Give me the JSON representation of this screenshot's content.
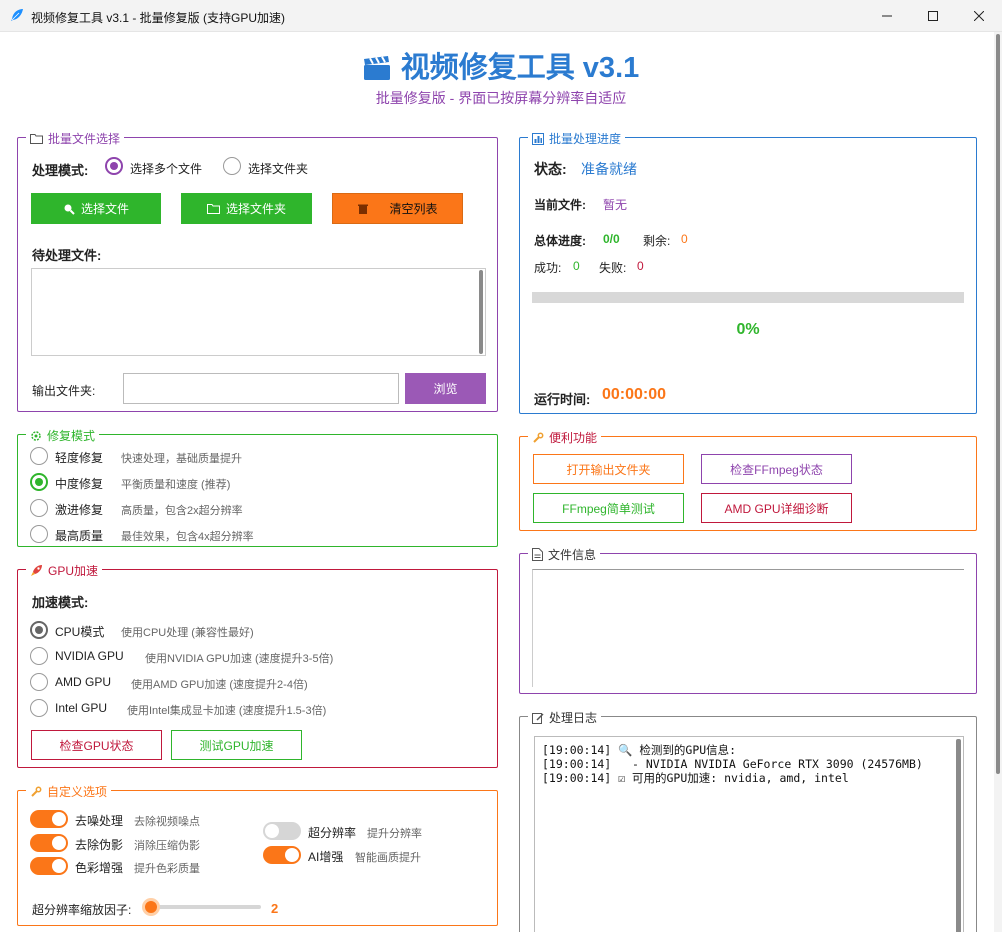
{
  "window": {
    "title": "视频修复工具 v3.1 - 批量修复版 (支持GPU加速)",
    "minimize": "—",
    "maximize": "☐",
    "close": "✕"
  },
  "header": {
    "title": "视频修复工具 v3.1",
    "subtitle": "批量修复版 - 界面已按屏幕分辨率自适应"
  },
  "batch": {
    "legend": "批量文件选择",
    "mode_label": "处理模式:",
    "mode_options": [
      "选择多个文件",
      "选择文件夹"
    ],
    "mode_selected": "选择多个文件",
    "select_files": "选择文件",
    "select_folder": "选择文件夹",
    "clear_list": "清空列表",
    "pending_label": "待处理文件:",
    "output_label": "输出文件夹:",
    "output_value": "",
    "browse": "浏览"
  },
  "repair": {
    "legend": "修复模式",
    "selected": "中度修复",
    "options": [
      {
        "label": "轻度修复",
        "hint": "快速处理，基础质量提升"
      },
      {
        "label": "中度修复",
        "hint": "平衡质量和速度 (推荐)"
      },
      {
        "label": "激进修复",
        "hint": "高质量，包含2x超分辨率"
      },
      {
        "label": "最高质量",
        "hint": "最佳效果，包含4x超分辨率"
      }
    ]
  },
  "gpu": {
    "legend": "GPU加速",
    "mode_label": "加速模式:",
    "selected": "CPU模式",
    "options": [
      {
        "label": "CPU模式",
        "hint": "使用CPU处理 (兼容性最好)"
      },
      {
        "label": "NVIDIA GPU",
        "hint": "使用NVIDIA GPU加速 (速度提升3-5倍)"
      },
      {
        "label": "AMD GPU",
        "hint": "使用AMD GPU加速 (速度提升2-4倍)"
      },
      {
        "label": "Intel GPU",
        "hint": "使用Intel集成显卡加速 (速度提升1.5-3倍)"
      }
    ],
    "check_status": "检查GPU状态",
    "test_accel": "测试GPU加速"
  },
  "custom": {
    "legend": "自定义选项",
    "options": [
      {
        "label": "去噪处理",
        "hint": "去除视频噪点",
        "on": true
      },
      {
        "label": "去除伪影",
        "hint": "消除压缩伪影",
        "on": true
      },
      {
        "label": "色彩增强",
        "hint": "提升色彩质量",
        "on": true
      },
      {
        "label": "超分辨率",
        "hint": "提升分辨率",
        "on": false
      },
      {
        "label": "AI增强",
        "hint": "智能画质提升",
        "on": true
      }
    ],
    "scale_label": "超分辨率缩放因子:",
    "scale_value": "2"
  },
  "progress": {
    "legend": "批量处理进度",
    "status_label": "状态:",
    "status_value": "准备就绪",
    "current_label": "当前文件:",
    "current_value": "暂无",
    "total_label": "总体进度:",
    "total_value": "0/0",
    "remaining_label": "剩余:",
    "remaining_value": "0",
    "success_label": "成功:",
    "success_value": "0",
    "fail_label": "失败:",
    "fail_value": "0",
    "percent": "0%",
    "progress_fraction": 0,
    "runtime_label": "运行时间:",
    "runtime_value": "00:00:00"
  },
  "utilities": {
    "legend": "便利功能",
    "open_output": "打开输出文件夹",
    "check_ffmpeg": "检查FFmpeg状态",
    "ffmpeg_test": "FFmpeg简单测试",
    "amd_diag": "AMD GPU详细诊断"
  },
  "file_info": {
    "legend": "文件信息"
  },
  "log": {
    "legend": "处理日志",
    "lines": [
      "[19:00:14] 🔍 检测到的GPU信息:",
      "[19:00:14]   - NVIDIA NVIDIA GeForce RTX 3090 (24576MB)",
      "[19:00:14] ☑ 可用的GPU加速: nvidia, amd, intel"
    ]
  },
  "colors": {
    "purple": "#8e44ad",
    "green": "#2fb52c",
    "orange": "#fb7618",
    "red": "#c0183c",
    "blue": "#2b7bd0",
    "gray": "#666666"
  }
}
